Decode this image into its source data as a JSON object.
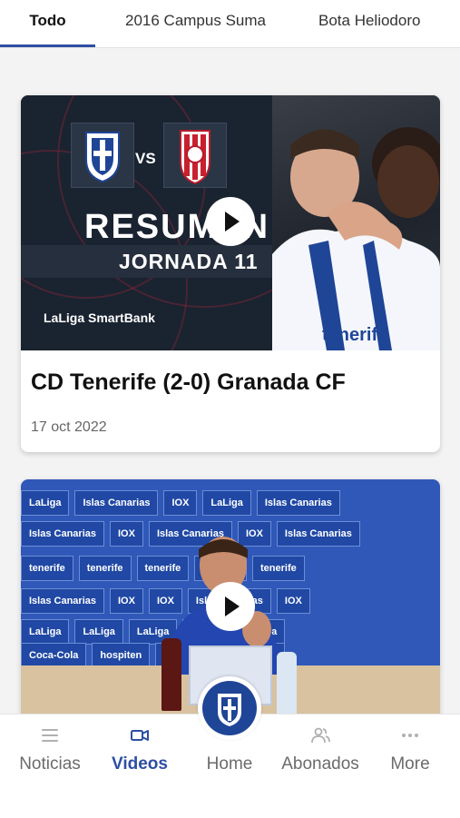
{
  "tabs": [
    {
      "label": "Todo",
      "active": true
    },
    {
      "label": "2016 Campus Suma",
      "active": false
    },
    {
      "label": "Bota Heliodoro",
      "active": false
    }
  ],
  "accent_color": "#2d4fa3",
  "videos": [
    {
      "title": "CD Tenerife (2-0) Granada CF",
      "date": "17 oct 2022",
      "thumbnail": {
        "vs": "VS",
        "headline": "RESUMEN",
        "subheadline": "JORNADA 11",
        "brand": "LaLiga SmartBank",
        "sponsor": "tenerife"
      }
    },
    {
      "thumbnail": {
        "sponsors": [
          "LaLiga",
          "Islas Canarias",
          "tenerife",
          "IOX",
          "Coca-Cola",
          "hospiten"
        ]
      }
    }
  ],
  "bottom_nav": [
    {
      "label": "Noticias",
      "icon": "list-icon",
      "active": false
    },
    {
      "label": "Videos",
      "icon": "video-camera-icon",
      "active": true
    },
    {
      "label": "Home",
      "icon": "club-crest-icon",
      "active": false
    },
    {
      "label": "Abonados",
      "icon": "users-icon",
      "active": false
    },
    {
      "label": "More",
      "icon": "more-dots-icon",
      "active": false
    }
  ]
}
